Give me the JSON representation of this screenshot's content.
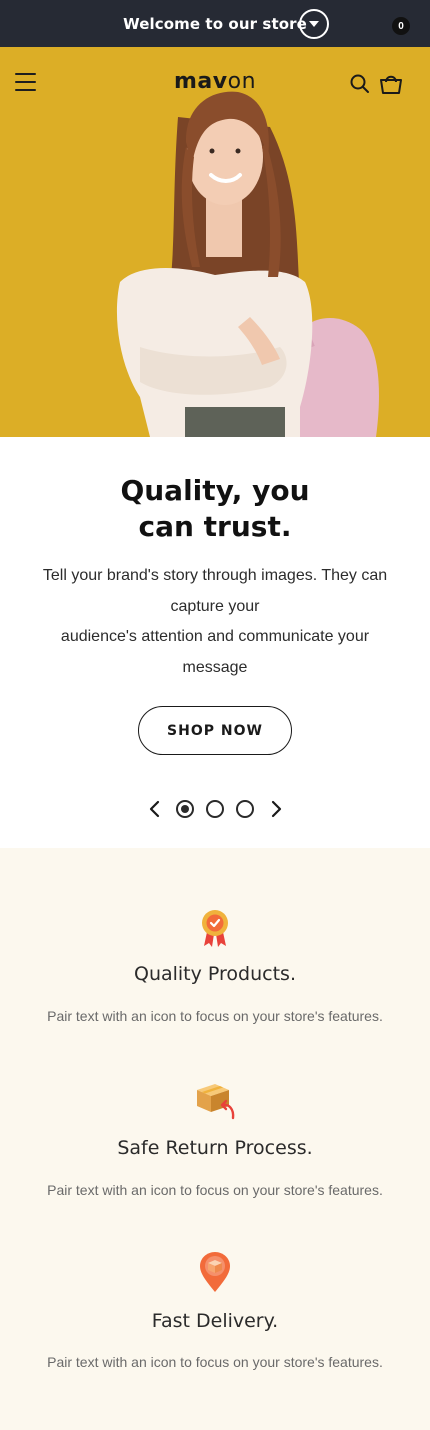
{
  "announcement": {
    "text": "Welcome to our store"
  },
  "header": {
    "logo_part1": "mav",
    "logo_part2": "on",
    "cart_count": "0"
  },
  "colors": {
    "announcement_bg": "#262a34",
    "hero_bg": "#dcae26",
    "features_bg": "#fcf8ee",
    "icon_orange": "#f26b3a",
    "icon_gold": "#f0b23c"
  },
  "slide": {
    "title_line1": "Quality, you",
    "title_line2": "can trust.",
    "text_line1": "Tell your brand's story through images. They can",
    "text_line2": "capture your",
    "text_line3": "audience's attention and communicate your",
    "text_line4": "message",
    "button_label": "SHOP NOW",
    "total_slides": 3,
    "active_slide": 1
  },
  "features": [
    {
      "icon": "quality-badge-icon",
      "title": "Quality Products.",
      "text": "Pair text with an icon to focus on your store's features."
    },
    {
      "icon": "return-box-icon",
      "title": "Safe Return Process.",
      "text": "Pair text with an icon to focus on your store's features."
    },
    {
      "icon": "delivery-pin-icon",
      "title": "Fast Delivery.",
      "text": "Pair text with an icon to focus on your store's features."
    }
  ]
}
